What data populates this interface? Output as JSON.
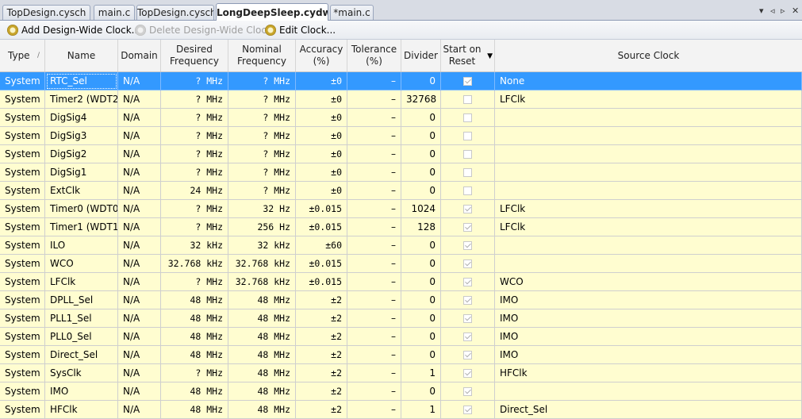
{
  "tabs": [
    {
      "label": "TopDesign.cysch"
    },
    {
      "label": "main.c"
    },
    {
      "label": "TopDesign.cysch"
    },
    {
      "label": "LongDeepSleep.cydwr"
    },
    {
      "label": "*main.c"
    }
  ],
  "tab_controls": {
    "dropdown": "▾",
    "prev": "◃",
    "next": "▹",
    "close": "✕"
  },
  "toolbar": {
    "add_label": "Add Design-Wide Clock...",
    "delete_label": "Delete Design-Wide Clock",
    "edit_label": "Edit Clock..."
  },
  "columns": {
    "type": "Type",
    "name": "Name",
    "domain": "Domain",
    "desired_freq": "Desired\nFrequency",
    "nominal_freq": "Nominal\nFrequency",
    "accuracy": "Accuracy\n(%)",
    "tolerance": "Tolerance\n(%)",
    "divider": "Divider",
    "start_on_reset": "Start on\nReset",
    "source_clock": "Source Clock"
  },
  "rows": [
    {
      "type": "System",
      "name": "RTC_Sel",
      "domain": "N/A",
      "desired": "? MHz",
      "nominal": "? MHz",
      "accuracy": "±0",
      "tolerance": "–",
      "divider": "0",
      "start": true,
      "source": "None"
    },
    {
      "type": "System",
      "name": "Timer2 (WDT2)",
      "domain": "N/A",
      "desired": "? MHz",
      "nominal": "? MHz",
      "accuracy": "±0",
      "tolerance": "–",
      "divider": "32768",
      "start": false,
      "source": "LFClk"
    },
    {
      "type": "System",
      "name": "DigSig4",
      "domain": "N/A",
      "desired": "? MHz",
      "nominal": "? MHz",
      "accuracy": "±0",
      "tolerance": "–",
      "divider": "0",
      "start": false,
      "source": ""
    },
    {
      "type": "System",
      "name": "DigSig3",
      "domain": "N/A",
      "desired": "? MHz",
      "nominal": "? MHz",
      "accuracy": "±0",
      "tolerance": "–",
      "divider": "0",
      "start": false,
      "source": ""
    },
    {
      "type": "System",
      "name": "DigSig2",
      "domain": "N/A",
      "desired": "? MHz",
      "nominal": "? MHz",
      "accuracy": "±0",
      "tolerance": "–",
      "divider": "0",
      "start": false,
      "source": ""
    },
    {
      "type": "System",
      "name": "DigSig1",
      "domain": "N/A",
      "desired": "? MHz",
      "nominal": "? MHz",
      "accuracy": "±0",
      "tolerance": "–",
      "divider": "0",
      "start": false,
      "source": ""
    },
    {
      "type": "System",
      "name": "ExtClk",
      "domain": "N/A",
      "desired": "24 MHz",
      "nominal": "? MHz",
      "accuracy": "±0",
      "tolerance": "–",
      "divider": "0",
      "start": false,
      "source": ""
    },
    {
      "type": "System",
      "name": "Timer0 (WDT0)",
      "domain": "N/A",
      "desired": "? MHz",
      "nominal": "32  Hz",
      "accuracy": "±0.015",
      "tolerance": "–",
      "divider": "1024",
      "start": true,
      "source": "LFClk"
    },
    {
      "type": "System",
      "name": "Timer1 (WDT1)",
      "domain": "N/A",
      "desired": "? MHz",
      "nominal": "256  Hz",
      "accuracy": "±0.015",
      "tolerance": "–",
      "divider": "128",
      "start": true,
      "source": "LFClk"
    },
    {
      "type": "System",
      "name": "ILO",
      "domain": "N/A",
      "desired": "32 kHz",
      "nominal": "32 kHz",
      "accuracy": "±60",
      "tolerance": "–",
      "divider": "0",
      "start": true,
      "source": ""
    },
    {
      "type": "System",
      "name": "WCO",
      "domain": "N/A",
      "desired": "32.768 kHz",
      "nominal": "32.768 kHz",
      "accuracy": "±0.015",
      "tolerance": "–",
      "divider": "0",
      "start": true,
      "source": ""
    },
    {
      "type": "System",
      "name": "LFClk",
      "domain": "N/A",
      "desired": "? MHz",
      "nominal": "32.768 kHz",
      "accuracy": "±0.015",
      "tolerance": "–",
      "divider": "0",
      "start": true,
      "source": "WCO"
    },
    {
      "type": "System",
      "name": "DPLL_Sel",
      "domain": "N/A",
      "desired": "48 MHz",
      "nominal": "48 MHz",
      "accuracy": "±2",
      "tolerance": "–",
      "divider": "0",
      "start": true,
      "source": "IMO"
    },
    {
      "type": "System",
      "name": "PLL1_Sel",
      "domain": "N/A",
      "desired": "48 MHz",
      "nominal": "48 MHz",
      "accuracy": "±2",
      "tolerance": "–",
      "divider": "0",
      "start": true,
      "source": "IMO"
    },
    {
      "type": "System",
      "name": "PLL0_Sel",
      "domain": "N/A",
      "desired": "48 MHz",
      "nominal": "48 MHz",
      "accuracy": "±2",
      "tolerance": "–",
      "divider": "0",
      "start": true,
      "source": "IMO"
    },
    {
      "type": "System",
      "name": "Direct_Sel",
      "domain": "N/A",
      "desired": "48 MHz",
      "nominal": "48 MHz",
      "accuracy": "±2",
      "tolerance": "–",
      "divider": "0",
      "start": true,
      "source": "IMO"
    },
    {
      "type": "System",
      "name": "SysClk",
      "domain": "N/A",
      "desired": "? MHz",
      "nominal": "48 MHz",
      "accuracy": "±2",
      "tolerance": "–",
      "divider": "1",
      "start": true,
      "source": "HFClk"
    },
    {
      "type": "System",
      "name": "IMO",
      "domain": "N/A",
      "desired": "48 MHz",
      "nominal": "48 MHz",
      "accuracy": "±2",
      "tolerance": "–",
      "divider": "0",
      "start": true,
      "source": ""
    },
    {
      "type": "System",
      "name": "HFClk",
      "domain": "N/A",
      "desired": "48 MHz",
      "nominal": "48 MHz",
      "accuracy": "±2",
      "tolerance": "–",
      "divider": "1",
      "start": true,
      "source": "Direct_Sel"
    }
  ],
  "colors": {
    "row_bg": "#fffdd0",
    "selected_bg": "#3399ff",
    "header_bg": "#f3f3f3"
  }
}
